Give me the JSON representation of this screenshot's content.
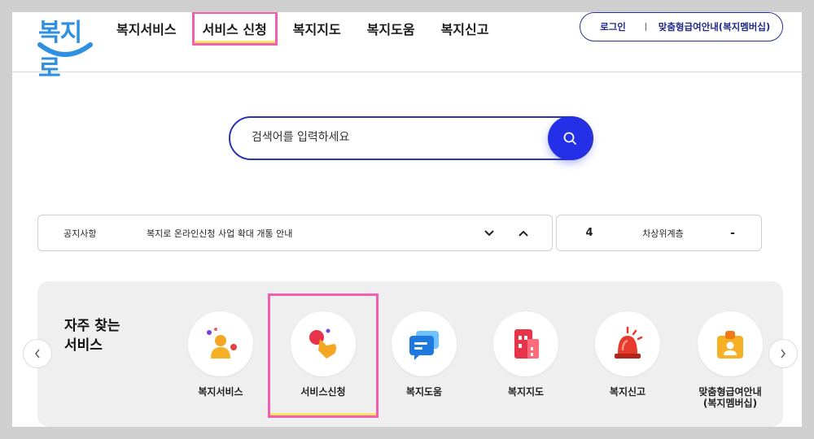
{
  "header": {
    "logo_text": "복지로",
    "nav": [
      {
        "label": "복지서비스"
      },
      {
        "label": "서비스 신청"
      },
      {
        "label": "복지지도"
      },
      {
        "label": "복지도움"
      },
      {
        "label": "복지신고"
      }
    ],
    "login_label": "로그인",
    "member_label": "맞춤형급여안내(복지멤버십)"
  },
  "search": {
    "placeholder": "검색어를 입력하세요",
    "icon": "search-icon"
  },
  "notice": {
    "label": "공지사항",
    "text": "복지로 온라인신청 사업 확대 개통 안내"
  },
  "counter": {
    "number": "4",
    "text": "차상위계층",
    "value": "-"
  },
  "frequent": {
    "title_line1": "자주 찾는",
    "title_line2": "서비스",
    "items": [
      {
        "label": "복지서비스",
        "icon": "welfare-person-icon"
      },
      {
        "label": "서비스신청",
        "icon": "touch-apply-icon"
      },
      {
        "label": "복지도움",
        "icon": "chat-bubble-icon"
      },
      {
        "label": "복지지도",
        "icon": "building-map-icon"
      },
      {
        "label": "복지신고",
        "icon": "siren-icon"
      },
      {
        "label_line1": "맞춤형급여안내",
        "label_line2": "(복지멤버십)",
        "icon": "membership-card-icon"
      }
    ]
  },
  "colors": {
    "brand_blue": "#2330e8",
    "nav_border": "#2c3290",
    "highlight_pink": "#f05fb0"
  }
}
